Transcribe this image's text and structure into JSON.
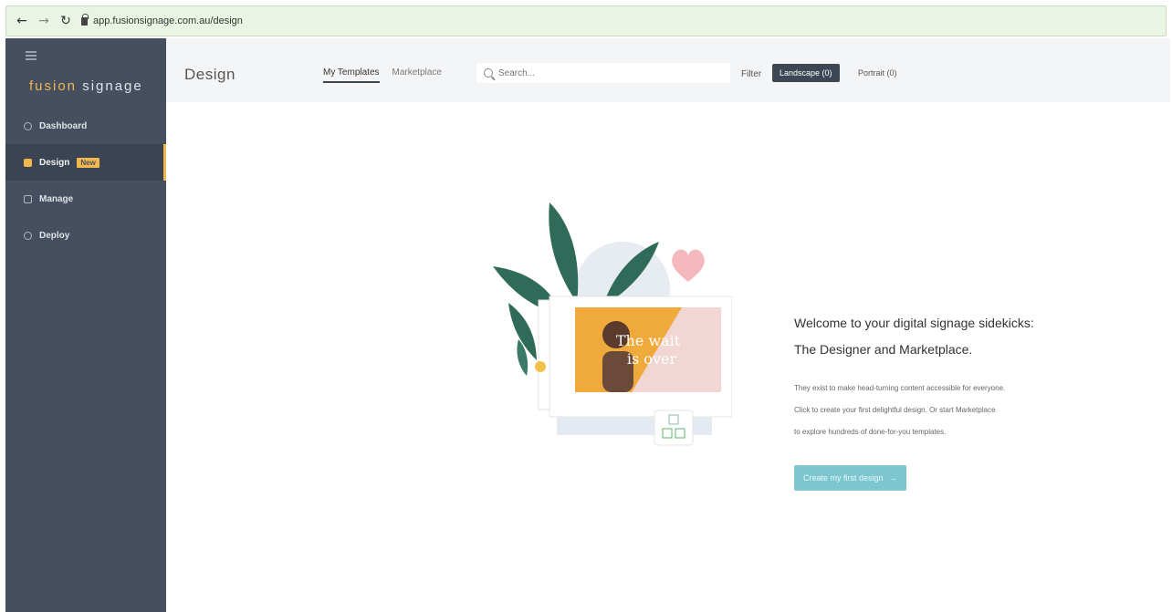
{
  "browser": {
    "url": "app.fusionsignage.com.au/design"
  },
  "sidebar": {
    "brand_first": "fusion",
    "brand_second": " signage",
    "items": [
      {
        "label": "Dashboard",
        "badge": ""
      },
      {
        "label": "Design",
        "badge": "New"
      },
      {
        "label": "Manage",
        "badge": ""
      },
      {
        "label": "Deploy",
        "badge": ""
      }
    ]
  },
  "header": {
    "title": "Design",
    "tabs": [
      "My Templates",
      "Marketplace"
    ],
    "search_placeholder": "Search...",
    "filter_label": "Filter",
    "filters": [
      "Landscape (0)",
      "Portrait (0)"
    ]
  },
  "main": {
    "illustration_text_1": "The wait",
    "illustration_text_2": "is over",
    "welcome_line1": "Welcome to your digital signage sidekicks:",
    "welcome_line2": "The Designer and Marketplace.",
    "body_line1": "They exist to make head-turning content accessible for everyone.",
    "body_line2": "Click to create your first delightful design. Or start Marketplace",
    "body_line3": "to explore hundreds of done-for-you templates.",
    "cta_label": "Create my first design"
  },
  "colors": {
    "sidebar": "#454f5f",
    "accent": "#f2b84b",
    "cta": "#7cc6cf"
  }
}
